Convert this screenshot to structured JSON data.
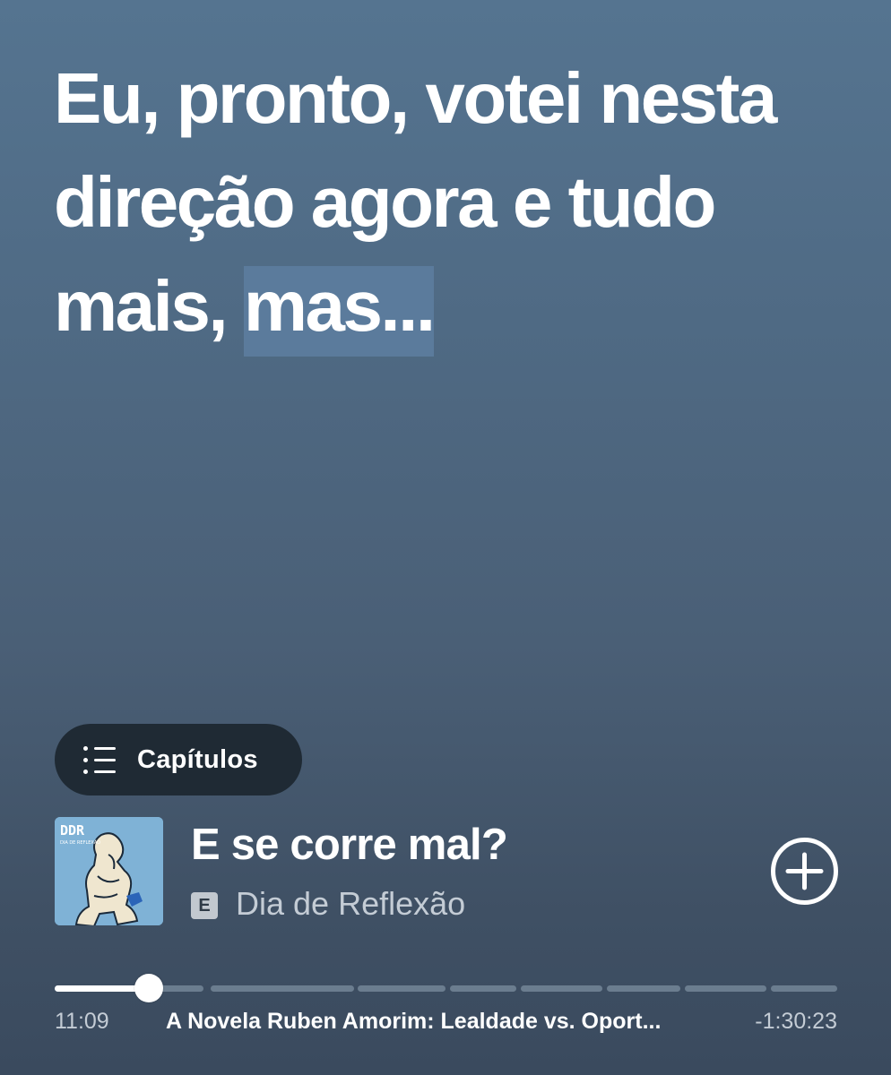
{
  "transcript": {
    "text": "Eu, pronto, votei nesta direção agora e tudo mais,",
    "highlighted_word": "mas..."
  },
  "chapters_button": {
    "label": "Capítulos",
    "icon": "list-icon"
  },
  "episode": {
    "title": "E se corre mal?",
    "explicit_badge": "E",
    "show_name": "Dia de Reflexão",
    "cover_text_main": "DDR",
    "cover_text_sub": "DIA DE REFLEXÃO"
  },
  "add_button": {
    "icon": "plus-circle-icon"
  },
  "playback": {
    "elapsed": "11:09",
    "remaining": "-1:30:23",
    "chapter_title": "A Novela Ruben Amorim: Lealdade vs. Oport...",
    "progress_fraction": 0.12
  },
  "colors": {
    "background_top": "#557490",
    "background_bottom": "#3a4a5e",
    "highlight": "#5b7b9c",
    "pill": "#1f2a34",
    "muted_text": "#c4ccd5"
  }
}
